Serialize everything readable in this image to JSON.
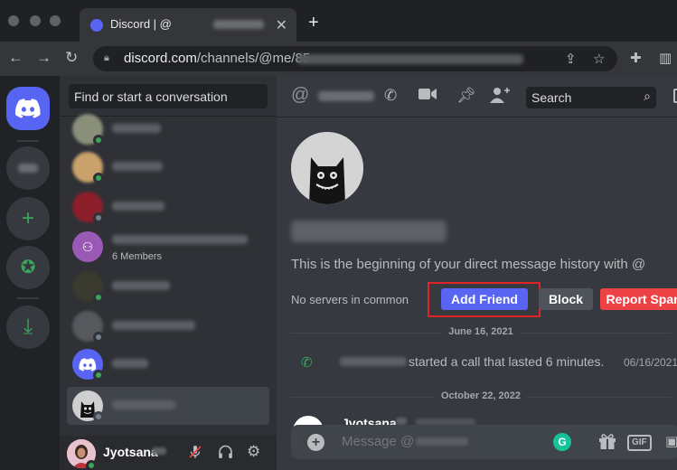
{
  "browser": {
    "tab_title": "Discord | @",
    "tab_close": "✕",
    "new_tab": "+",
    "url_host": "discord.com",
    "url_path": "/channels/@me/85"
  },
  "servers": {
    "add_glyph": "+",
    "explore_glyph": "✪",
    "download_glyph": "⤓"
  },
  "dm_list": {
    "search_placeholder": "Find or start a conversation",
    "group_members": "6 Members"
  },
  "user_panel": {
    "username": "Jyotsana"
  },
  "header": {
    "at_symbol": "@",
    "search_placeholder": "Search"
  },
  "profile": {
    "intro_text": "This is the beginning of your direct message history with @",
    "no_servers": "No servers in common",
    "add_friend_label": "Add Friend",
    "block_label": "Block",
    "report_label": "Report Spam"
  },
  "messages": {
    "date_1": "June 16, 2021",
    "call_text": "started a call that lasted 6 minutes.",
    "call_time": "06/16/2021",
    "date_2": "October 22, 2022",
    "author": "Jyotsana"
  },
  "composer": {
    "placeholder": "Message @",
    "grammarly_label": "G",
    "gif_label": "GIF"
  },
  "colors": {
    "blurple": "#5865f2",
    "green": "#3ba55c",
    "red": "#ed4245",
    "highlight_box": "#e02424"
  }
}
